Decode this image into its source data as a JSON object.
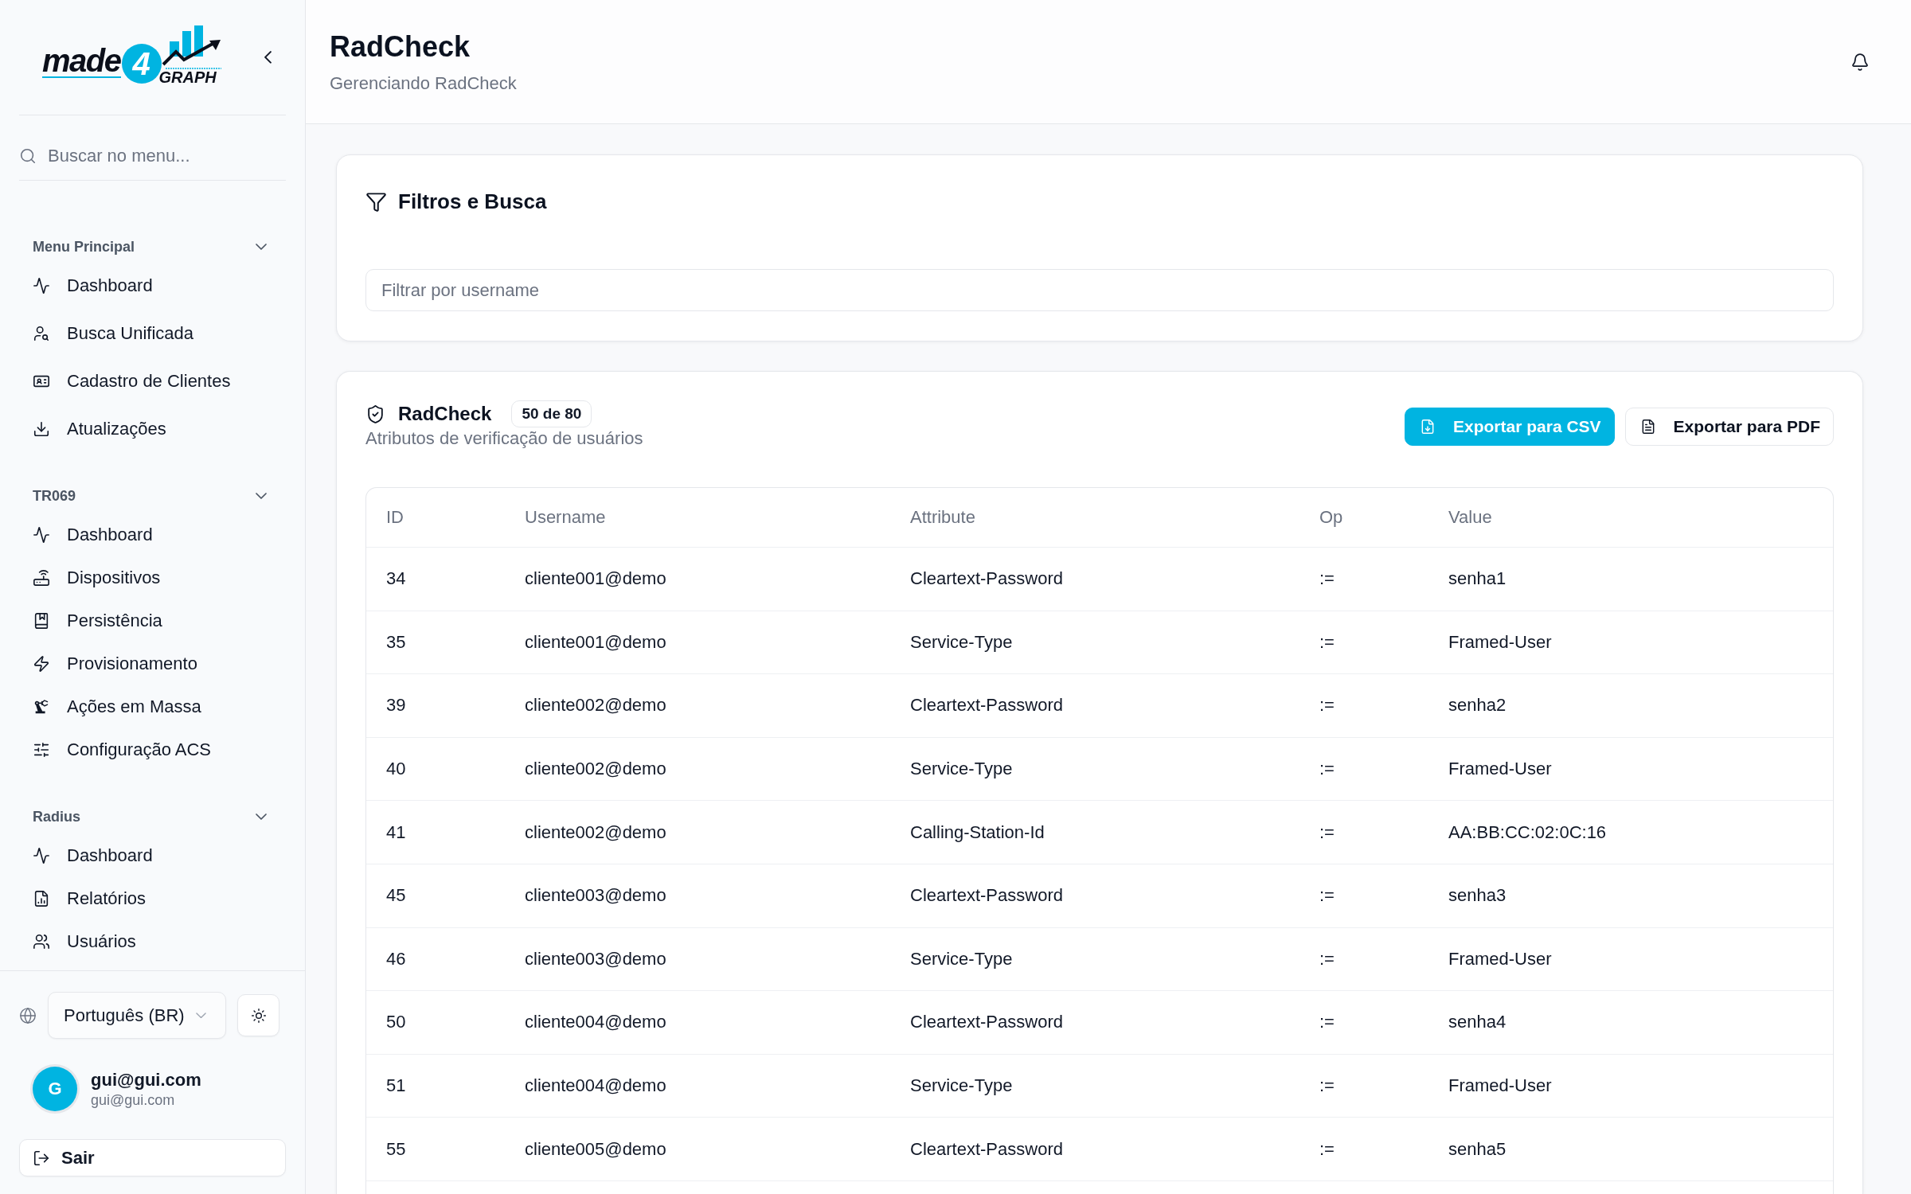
{
  "sidebar": {
    "logo": {
      "word": "made",
      "digit": "4",
      "tagline": "GRAPH"
    },
    "search": {
      "placeholder": "Buscar no menu..."
    },
    "sections": [
      {
        "title": "Menu Principal",
        "expanded": true,
        "items": [
          "Dashboard",
          "Busca Unificada",
          "Cadastro de Clientes",
          "Atualizações"
        ]
      },
      {
        "title": "TR069",
        "expanded": true,
        "items": [
          "Dashboard",
          "Dispositivos",
          "Persistência",
          "Provisionamento",
          "Ações em Massa",
          "Configuração ACS"
        ]
      },
      {
        "title": "Radius",
        "expanded": true,
        "items": [
          "Dashboard",
          "Relatórios",
          "Usuários"
        ]
      }
    ],
    "language": {
      "value": "Português (BR)"
    },
    "user": {
      "initial": "G",
      "name": "gui@gui.com",
      "email": "gui@gui.com"
    },
    "logout": "Sair"
  },
  "header": {
    "title": "RadCheck",
    "subtitle": "Gerenciando RadCheck"
  },
  "filters": {
    "title": "Filtros e Busca",
    "search": {
      "placeholder": "Filtrar por username"
    }
  },
  "table_card": {
    "title": "RadCheck",
    "badge": "50 de 80",
    "subtitle": "Atributos de verificação de usuários",
    "buttons": [
      {
        "label": "Exportar para CSV",
        "kind": "primary"
      },
      {
        "label": "Exportar para PDF",
        "kind": "outline"
      }
    ],
    "table": {
      "columns": [
        "ID",
        "Username",
        "Attribute",
        "Op",
        "Value"
      ],
      "rows": [
        [
          "34",
          "cliente001@demo",
          "Cleartext-Password",
          ":=",
          "senha1"
        ],
        [
          "35",
          "cliente001@demo",
          "Service-Type",
          ":=",
          "Framed-User"
        ],
        [
          "39",
          "cliente002@demo",
          "Cleartext-Password",
          ":=",
          "senha2"
        ],
        [
          "40",
          "cliente002@demo",
          "Service-Type",
          ":=",
          "Framed-User"
        ],
        [
          "41",
          "cliente002@demo",
          "Calling-Station-Id",
          ":=",
          "AA:BB:CC:02:0C:16"
        ],
        [
          "45",
          "cliente003@demo",
          "Cleartext-Password",
          ":=",
          "senha3"
        ],
        [
          "46",
          "cliente003@demo",
          "Service-Type",
          ":=",
          "Framed-User"
        ],
        [
          "50",
          "cliente004@demo",
          "Cleartext-Password",
          ":=",
          "senha4"
        ],
        [
          "51",
          "cliente004@demo",
          "Service-Type",
          ":=",
          "Framed-User"
        ],
        [
          "55",
          "cliente005@demo",
          "Cleartext-Password",
          ":=",
          "senha5"
        ]
      ]
    }
  }
}
